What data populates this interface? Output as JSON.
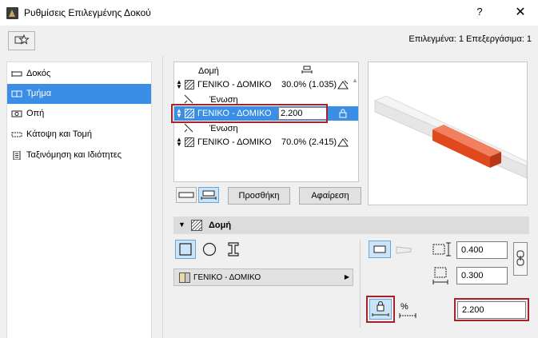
{
  "window": {
    "title": "Ρυθμίσεις Επιλεγμένης Δοκού",
    "help_label": "?",
    "close_label": "✕"
  },
  "toolbar": {
    "selection_info": "Επιλεγμένα: 1 Επεξεργάσιμα: 1"
  },
  "sidebar": {
    "items": [
      {
        "label": "Δοκός",
        "icon": "beam-icon",
        "selected": false
      },
      {
        "label": "Τμήμα",
        "icon": "segment-icon",
        "selected": true
      },
      {
        "label": "Οπή",
        "icon": "hole-icon",
        "selected": false
      },
      {
        "label": "Κάτοψη και Τομή",
        "icon": "floor-plan-section-icon",
        "selected": false
      },
      {
        "label": "Ταξινόμηση και Ιδιότητες",
        "icon": "classification-icon",
        "selected": false
      }
    ]
  },
  "segments": {
    "header": "Δομή",
    "rows": [
      {
        "name": "ΓΕΝΙΚΟ - ΔΟΜΙΚΟ",
        "value": "30.0% (1.035)",
        "selected": false
      },
      {
        "name": "ΓΕΝΙΚΟ - ΔΟΜΙΚΟ",
        "value": "2.200",
        "selected": true
      },
      {
        "name": "ΓΕΝΙΚΟ - ΔΟΜΙΚΟ",
        "value": "70.0% (2.415)",
        "selected": false
      }
    ],
    "connection_label": "Ένωση",
    "add_label": "Προσθήκη",
    "remove_label": "Αφαίρεση"
  },
  "structure": {
    "section_title": "Δομή",
    "material": "ΓΕΝΙΚΟ - ΔΟΜΙΚΟ",
    "width": "0.400",
    "height": "0.300",
    "length": "2.200",
    "percent_label": "%"
  },
  "colors": {
    "accent": "#3a8ee6",
    "highlight_frame": "#a7212a",
    "segment_preview": "#e0491e"
  }
}
